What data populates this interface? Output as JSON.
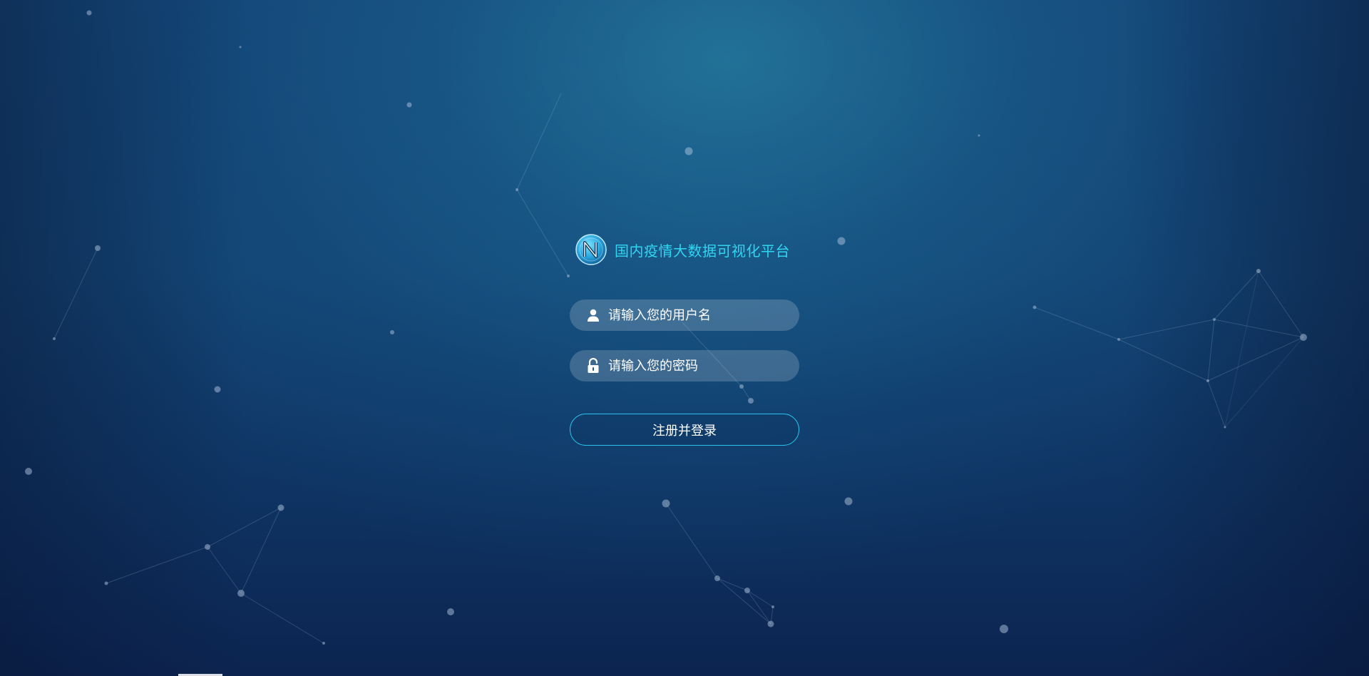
{
  "app": {
    "title": "国内疫情大数据可视化平台",
    "logo_icon": "n-letter-logo-icon"
  },
  "form": {
    "username": {
      "value": "",
      "placeholder": "请输入您的用户名",
      "icon": "user-icon"
    },
    "password": {
      "value": "",
      "placeholder": "请输入您的密码",
      "icon": "unlocked-lock-icon"
    },
    "submit_label": "注册并登录"
  },
  "colors": {
    "accent": "#2fd6f2",
    "button_border": "#27c3ea",
    "background_top": "#1b6c93",
    "background_bottom": "#0c2450",
    "input_fill": "rgba(255,255,255,0.18)"
  }
}
